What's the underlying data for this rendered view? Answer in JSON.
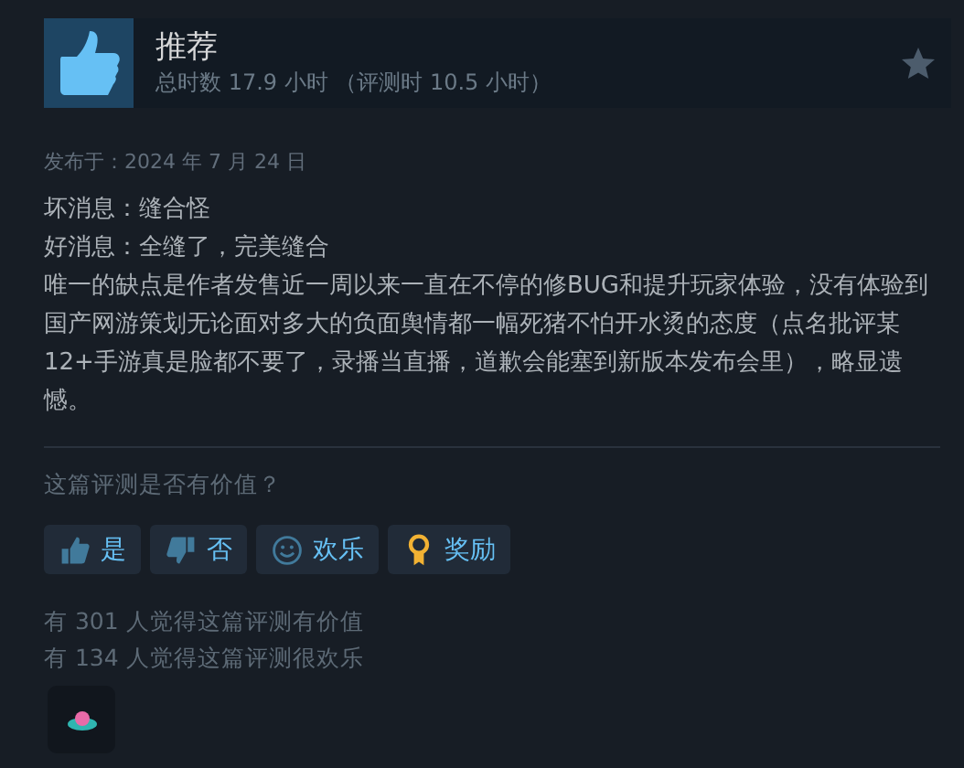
{
  "review": {
    "verdict": "推荐",
    "hours": "总时数 17.9 小时 （评测时 10.5 小时）",
    "posted": "发布于：2024 年 7 月 24 日",
    "paragraphs": [
      "坏消息：缝合怪",
      "好消息：全缝了，完美缝合",
      "唯一的缺点是作者发售近一周以来一直在不停的修BUG和提升玩家体验，没有体验到国产网游策划无论面对多大的负面舆情都一幅死猪不怕开水烫的态度（点名批评某12+手游真是脸都不要了，录播当直播，道歉会能塞到新版本发布会里），略显遗憾。"
    ]
  },
  "helpful_prompt": "这篇评测是否有价值？",
  "buttons": [
    {
      "kind": "yes",
      "label": "是"
    },
    {
      "kind": "no",
      "label": "否"
    },
    {
      "kind": "funny",
      "label": "欢乐"
    },
    {
      "kind": "award",
      "label": "奖励"
    }
  ],
  "counts": [
    "有 301 人觉得这篇评测有价值",
    "有 134 人觉得这篇评测很欢乐"
  ]
}
